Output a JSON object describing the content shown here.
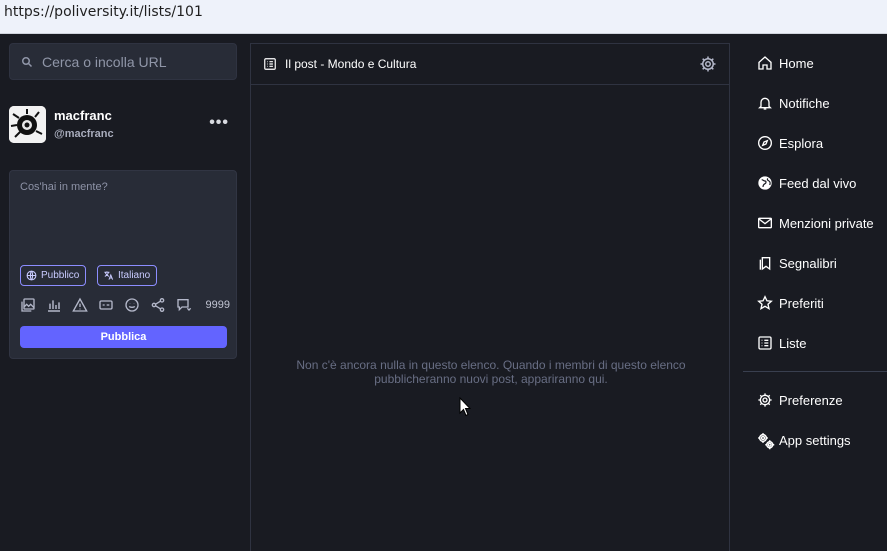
{
  "browser": {
    "url": "https://poliversity.it/lists/101"
  },
  "search": {
    "placeholder": "Cerca o incolla URL"
  },
  "account": {
    "display_name": "macfranc",
    "handle": "@macfranc",
    "menu_label": "•••"
  },
  "compose": {
    "placeholder": "Cos'hai in mente?",
    "visibility_label": "Pubblico",
    "language_label": "Italiano",
    "char_counter": "9999",
    "publish_label": "Pubblica"
  },
  "column": {
    "title": "Il post - Mondo e Cultura",
    "empty_message": "Non c'è ancora nulla in questo elenco. Quando i membri di questo elenco pubblicheranno nuovi post, appariranno qui."
  },
  "nav": {
    "items": [
      {
        "label": "Home",
        "icon": "home-icon"
      },
      {
        "label": "Notifiche",
        "icon": "bell-icon"
      },
      {
        "label": "Esplora",
        "icon": "compass-icon"
      },
      {
        "label": "Feed dal vivo",
        "icon": "globe-icon"
      },
      {
        "label": "Menzioni private",
        "icon": "mail-icon"
      },
      {
        "label": "Segnalibri",
        "icon": "bookmarks-icon"
      },
      {
        "label": "Preferiti",
        "icon": "star-icon"
      },
      {
        "label": "Liste",
        "icon": "list-icon"
      }
    ],
    "settings": [
      {
        "label": "Preferenze",
        "icon": "gear-icon"
      },
      {
        "label": "App settings",
        "icon": "gears-icon"
      }
    ]
  },
  "colors": {
    "accent": "#6364ff",
    "background": "#191b22",
    "panel": "#282c37"
  }
}
